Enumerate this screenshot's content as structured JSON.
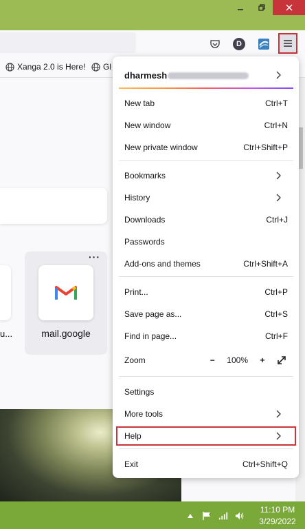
{
  "window": {
    "controls": [
      "minimize",
      "maximize",
      "close"
    ]
  },
  "toolbar": {
    "icons": [
      "pocket-icon",
      "account-avatar-icon",
      "extension-icon",
      "hamburger-menu-icon"
    ],
    "avatar_letter": "D"
  },
  "bookmarks": {
    "items": [
      {
        "label": "Xanga 2.0 is Here!",
        "icon": "globe-icon"
      },
      {
        "label": "Gl",
        "icon": "globe-icon"
      }
    ]
  },
  "newtab": {
    "left_tile_label": "u...",
    "tile": {
      "label": "mail.google",
      "icon": "gmail-icon",
      "more": "···"
    }
  },
  "menu": {
    "account": {
      "name": "dharmesh"
    },
    "items_group1": [
      {
        "label": "New tab",
        "shortcut": "Ctrl+T"
      },
      {
        "label": "New window",
        "shortcut": "Ctrl+N"
      },
      {
        "label": "New private window",
        "shortcut": "Ctrl+Shift+P"
      }
    ],
    "items_group2": [
      {
        "label": "Bookmarks",
        "shortcut": ""
      },
      {
        "label": "History",
        "shortcut": ""
      },
      {
        "label": "Downloads",
        "shortcut": "Ctrl+J"
      },
      {
        "label": "Passwords",
        "shortcut": ""
      },
      {
        "label": "Add-ons and themes",
        "shortcut": "Ctrl+Shift+A"
      }
    ],
    "items_group3": [
      {
        "label": "Print...",
        "shortcut": "Ctrl+P"
      },
      {
        "label": "Save page as...",
        "shortcut": "Ctrl+S"
      },
      {
        "label": "Find in page...",
        "shortcut": "Ctrl+F"
      }
    ],
    "zoom": {
      "label": "Zoom",
      "minus": "−",
      "value": "100%",
      "plus": "+"
    },
    "items_group4": [
      {
        "label": "Settings",
        "shortcut": ""
      },
      {
        "label": "More tools",
        "shortcut": ""
      },
      {
        "label": "Help",
        "shortcut": ""
      }
    ],
    "exit": {
      "label": "Exit",
      "shortcut": "Ctrl+Shift+Q"
    }
  },
  "taskbar": {
    "time": "11:10 PM",
    "date": "3/29/2022",
    "tray_icons": [
      "show-hidden-icons",
      "flag-icon",
      "network-icon",
      "volume-icon"
    ]
  },
  "colors": {
    "titlebar": "#9cbb55",
    "taskbar": "#7aa93a",
    "highlight": "#c7343a"
  }
}
